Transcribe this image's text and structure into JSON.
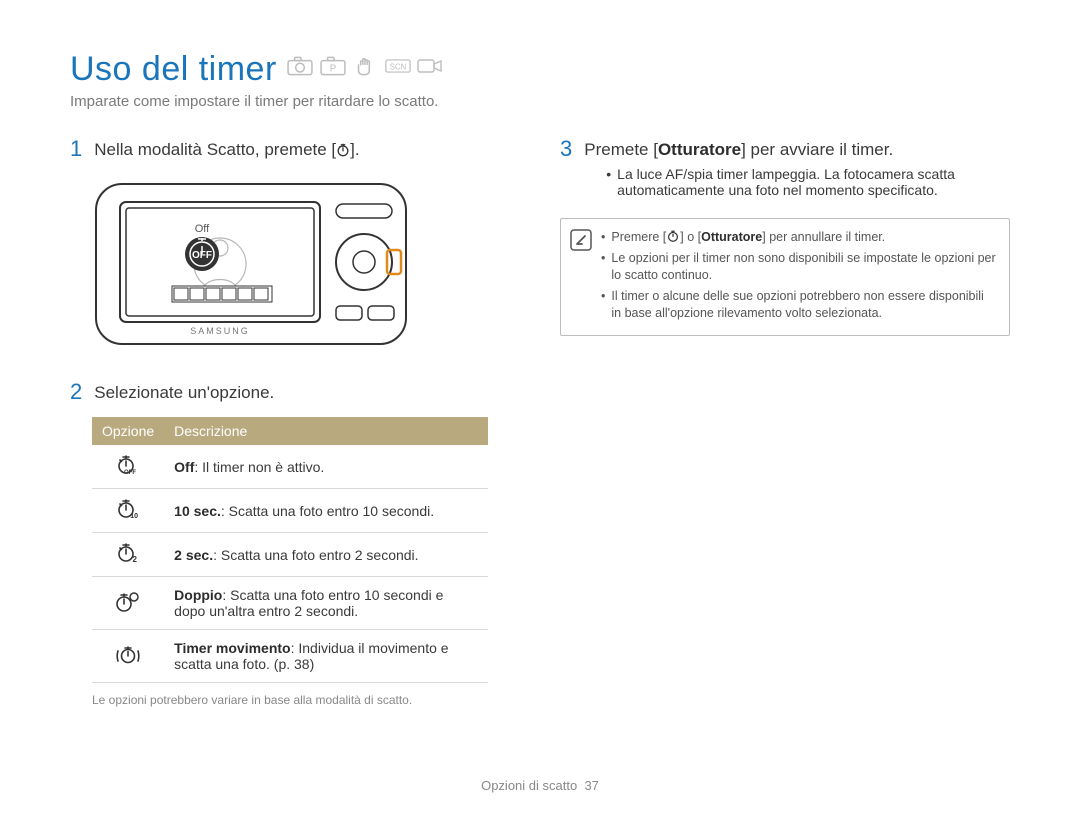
{
  "title": "Uso del timer",
  "mode_icons": [
    "camera-smart-icon",
    "camera-p-icon",
    "hand-icon",
    "scn-icon",
    "video-icon"
  ],
  "subtitle": "Imparate come impostare il timer per ritardare lo scatto.",
  "step1": {
    "num": "1",
    "before": "Nella modalità Scatto, premete [",
    "after": "]."
  },
  "step2": {
    "num": "2",
    "text": "Selezionate un'opzione."
  },
  "camera_badge": "Off",
  "camera_brand": "SAMSUNG",
  "table": {
    "head": {
      "opt": "Opzione",
      "desc": "Descrizione"
    },
    "rows": [
      {
        "icon": "timer-off-icon",
        "bold": "Off",
        "rest": ": Il timer non è attivo."
      },
      {
        "icon": "timer-10-icon",
        "bold": "10 sec.",
        "rest": ": Scatta una foto entro 10 secondi."
      },
      {
        "icon": "timer-2-icon",
        "bold": "2 sec.",
        "rest": ": Scatta una foto entro 2 secondi."
      },
      {
        "icon": "timer-double-icon",
        "bold": "Doppio",
        "rest": ": Scatta una foto entro 10 secondi e dopo un'altra entro 2 secondi."
      },
      {
        "icon": "timer-motion-icon",
        "bold": "Timer movimento",
        "rest": ": Individua il movimento e scatta una foto. (p. 38)"
      }
    ]
  },
  "options_note": "Le opzioni potrebbero variare in base alla modalità di scatto.",
  "step3": {
    "num": "3",
    "before": "Premete [",
    "shutter": "Otturatore",
    "after": "] per avviare il timer.",
    "bullets": [
      "La luce AF/spia timer lampeggia. La fotocamera scatta automaticamente una foto nel momento specificato."
    ]
  },
  "infobox": [
    {
      "before": "Premere [",
      "mid1": "] o [",
      "shutter": "Otturatore",
      "after": "] per annullare il timer."
    },
    {
      "text": "Le opzioni per il timer non sono disponibili se impostate le opzioni per lo scatto continuo."
    },
    {
      "text": "Il timer o alcune delle sue opzioni potrebbero non essere disponibili in base all'opzione rilevamento volto selezionata."
    }
  ],
  "footer": {
    "label": "Opzioni di scatto",
    "page": "37"
  }
}
